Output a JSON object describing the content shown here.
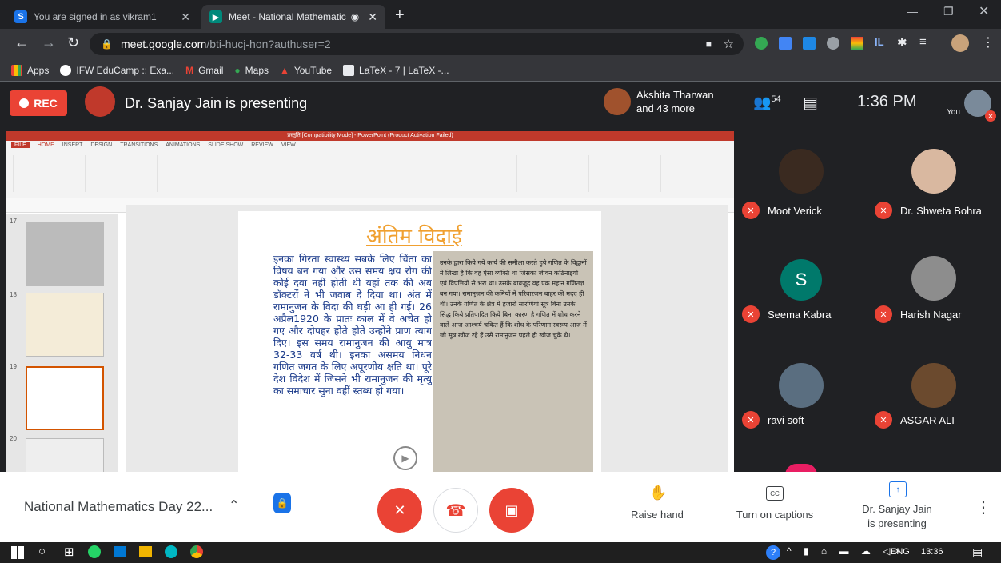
{
  "browser": {
    "tabs": [
      {
        "title": "You are signed in as vikram1",
        "active": false
      },
      {
        "title": "Meet - National Mathematic",
        "active": true
      }
    ],
    "new_tab": "+",
    "url_host": "meet.google.com",
    "url_path": "/bti-hucj-hon?authuser=2",
    "bookmarks": [
      "Apps",
      "IFW EduCamp :: Exa...",
      "Gmail",
      "Maps",
      "YouTube",
      "LaTeX - 7 | LaTeX -..."
    ]
  },
  "meet": {
    "rec_label": "REC",
    "presenter_title": "Dr. Sanjay Jain is presenting",
    "top_participants": {
      "name": "Akshita Tharwan",
      "more": "and 43 more"
    },
    "participant_count": "54",
    "time": "1:36 PM",
    "you_label": "You",
    "participants": [
      {
        "name": "Moot Verick",
        "initial": ""
      },
      {
        "name": "Dr. Shweta Bohra",
        "initial": ""
      },
      {
        "name": "Seema Kabra",
        "initial": "S"
      },
      {
        "name": "Harish Nagar",
        "initial": ""
      },
      {
        "name": "ravi soft",
        "initial": ""
      },
      {
        "name": "ASGAR ALI",
        "initial": ""
      }
    ],
    "meeting_title": "National Mathematics Day 22...",
    "raise_hand": "Raise hand",
    "captions": "Turn on captions",
    "presenting_line1": "Dr. Sanjay Jain",
    "presenting_line2": "is presenting"
  },
  "slide": {
    "ppt_title": "प्रस्तुति [Compatibility Mode] - PowerPoint (Product Activation Failed)",
    "ribbon_tabs": [
      "FILE",
      "HOME",
      "INSERT",
      "DESIGN",
      "TRANSITIONS",
      "ANIMATIONS",
      "SLIDE SHOW",
      "REVIEW",
      "VIEW"
    ],
    "slide_numbers": [
      "17",
      "18",
      "19",
      "20"
    ],
    "heading": "अंतिम विदाई",
    "body": "इनका गिरता स्वास्थ्य सबके लिए चिंता का विषय बन गया और उस समय क्षय रोग की कोई दवा नहीं होती थी यहां तक की अब डॉक्टरों ने भी जवाब दे दिया था। अंत में रामानुजन के विदा की घड़ी आ ही गई। 26 अप्रैल1920 के प्रातः काल में वे अचेत हो गए और दोपहर होते होते उन्होंने प्राण त्याग दिए। इस समय रामानुजन की आयु मात्र 32-33 वर्ष थी। इनका असमय निधन गणित जगत के लिए अपूरणीय क्षति था। पूरे देश विदेश में जिसने भी रामानुजन की मृत्यु का समाचार सुना वहीं स्तब्ध हो गया।",
    "clipping": "उनके द्वारा किये गये कार्य की समीक्षा करते हुये गणित के विद्वानों ने लिखा है कि वह ऐसा व्यक्ति था जिसका जीवन कठिनाइयों एवं विपत्तियों से भरा था। उसके बावजूद वह एक महान गणितज्ञ बन गया। रामानुजन की कमियों में परिवारजन बाहर की मदद ही थी। उनके गणित के क्षेत्र में हजारों सारणियां सूत्र बिना उनके सिद्ध किये प्रतिपादित किये बिना कारण है गणित में शोध करने वाले आज आश्चर्य चकित हैं कि शोध के परिणाम स्वरूप आज में जो सूत्र खोज रहे हैं उसे रामानुजन पहले ही खोज चुके थे।"
  },
  "taskbar": {
    "lang": "ENG",
    "time": "13:36"
  },
  "colors": {
    "red": "#ea4335",
    "dark": "#202124",
    "blue_heading": "#f0a030"
  }
}
